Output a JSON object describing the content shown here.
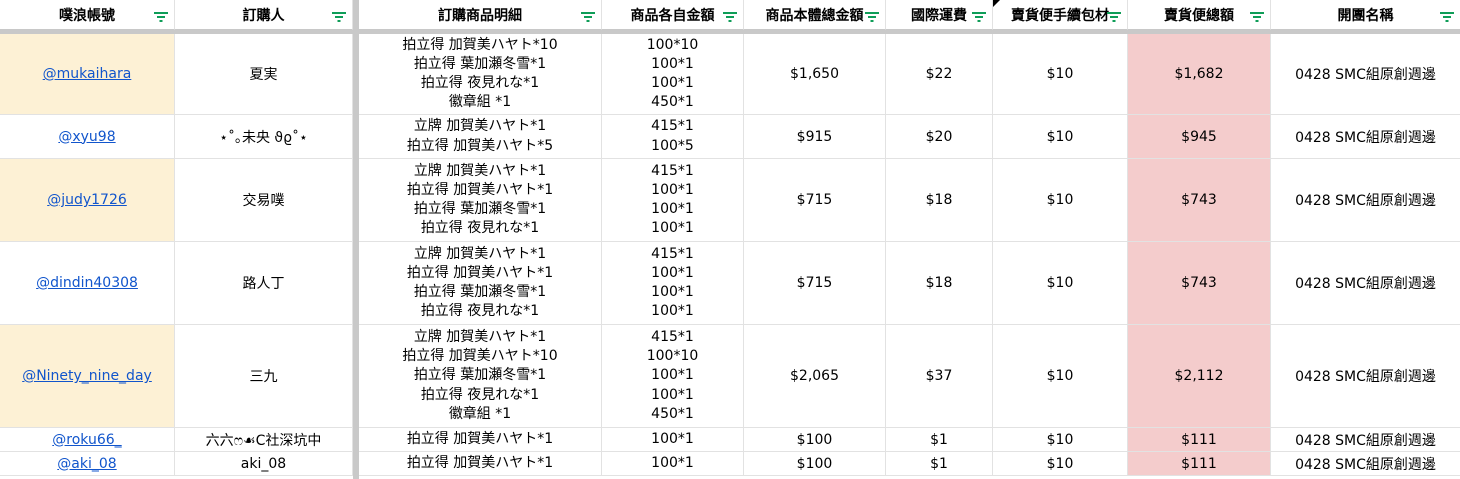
{
  "header": {
    "col0": "噗浪帳號",
    "col1": "訂購人",
    "col2": "訂購商品明細",
    "col3": "商品各自金額",
    "col4": "商品本體總金額",
    "col5": "國際運費",
    "col6": "賣貨便手續包材",
    "col7": "賣貨便總額",
    "col8": "開團名稱"
  },
  "colors": {
    "account_highlight": "#fdf1d5",
    "total_highlight": "#f4cccc",
    "filter_icon": "#0f9d58",
    "link": "#1155cc"
  },
  "rows": [
    {
      "account": "@mukaihara",
      "buyer": "夏実",
      "items": [
        "拍立得 加賀美ハヤト*10",
        "拍立得  葉加瀬冬雪*1",
        "拍立得 夜見れな*1",
        "徽章組   *1"
      ],
      "prices": [
        "100*10",
        "100*1",
        "100*1",
        "450*1"
      ],
      "subtotal": "$1,650",
      "shipping": "$22",
      "fee": "$10",
      "total": "$1,682",
      "group": "0428 SMC組原創週邊"
    },
    {
      "account": "@xyu98",
      "buyer": "⋆˚｡未央 ϑϱ˚⋆",
      "items": [
        "立牌 加賀美ハヤト*1",
        "拍立得 加賀美ハヤト*5"
      ],
      "prices": [
        "415*1",
        "100*5"
      ],
      "subtotal": "$915",
      "shipping": "$20",
      "fee": "$10",
      "total": "$945",
      "group": "0428 SMC組原創週邊"
    },
    {
      "account": "@judy1726",
      "buyer": "交易噗",
      "items": [
        "立牌 加賀美ハヤト*1",
        "拍立得 加賀美ハヤト*1",
        "拍立得  葉加瀬冬雪*1",
        "拍立得 夜見れな*1"
      ],
      "prices": [
        "415*1",
        "100*1",
        "100*1",
        "100*1"
      ],
      "subtotal": "$715",
      "shipping": "$18",
      "fee": "$10",
      "total": "$743",
      "group": "0428 SMC組原創週邊"
    },
    {
      "account": "@dindin40308",
      "buyer": "路人丁",
      "items": [
        "立牌 加賀美ハヤト*1",
        "拍立得 加賀美ハヤト*1",
        "拍立得  葉加瀬冬雪*1",
        "拍立得 夜見れな*1"
      ],
      "prices": [
        "415*1",
        "100*1",
        "100*1",
        "100*1"
      ],
      "subtotal": "$715",
      "shipping": "$18",
      "fee": "$10",
      "total": "$743",
      "group": "0428 SMC組原創週邊"
    },
    {
      "account": "@Ninety_nine_day",
      "buyer": "三九",
      "items": [
        "立牌 加賀美ハヤト*1",
        "拍立得 加賀美ハヤト*10",
        "拍立得  葉加瀬冬雪*1",
        "拍立得 夜見れな*1",
        "徽章組   *1"
      ],
      "prices": [
        "415*1",
        "100*10",
        "100*1",
        "100*1",
        "450*1"
      ],
      "subtotal": "$2,065",
      "shipping": "$37",
      "fee": "$10",
      "total": "$2,112",
      "group": "0428 SMC組原創週邊"
    },
    {
      "account": "@roku66_",
      "buyer": "六六ෆ☙C社深坑中",
      "items": [
        "拍立得 加賀美ハヤト*1"
      ],
      "prices": [
        "100*1"
      ],
      "subtotal": "$100",
      "shipping": "$1",
      "fee": "$10",
      "total": "$111",
      "group": "0428 SMC組原創週邊"
    },
    {
      "account": "@aki_08",
      "buyer": "aki_08",
      "items": [
        "拍立得 加賀美ハヤト*1"
      ],
      "prices": [
        "100*1"
      ],
      "subtotal": "$100",
      "shipping": "$1",
      "fee": "$10",
      "total": "$111",
      "group": "0428 SMC組原創週邊"
    }
  ]
}
